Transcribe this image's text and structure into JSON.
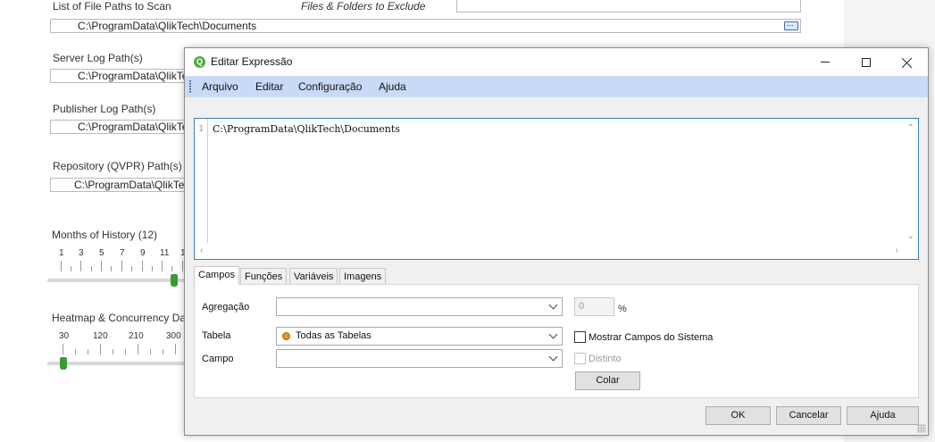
{
  "background": {
    "file_paths_label": "List of File Paths to Scan",
    "exclude_label": "Files & Folders to Exclude",
    "file_path_value": "C:\\ProgramData\\QlikTech\\Documents",
    "server_log_label": "Server Log Path(s)",
    "server_log_value": "C:\\ProgramData\\QlikTe",
    "publisher_log_label": "Publisher Log Path(s)",
    "publisher_log_value": "C:\\ProgramData\\QlikTe",
    "repository_label": "Repository (QVPR) Path(s)",
    "repository_value": "C:\\ProgramData\\QlikTec",
    "months_label": "Months of History (12)",
    "months_ticks": [
      "1",
      "3",
      "5",
      "7",
      "9",
      "11",
      "1"
    ],
    "months_value": 12,
    "heatmap_label": "Heatmap & Concurrency Da",
    "heatmap_ticks": [
      "30",
      "120",
      "210",
      "300"
    ],
    "heatmap_value": 30
  },
  "dialog": {
    "title": "Editar Expressão",
    "app_icon_letter": "Q",
    "menu": [
      "Arquivo",
      "Editar",
      "Configuração",
      "Ajuda"
    ],
    "editor": {
      "line_number": "1",
      "code": "C:\\ProgramData\\QlikTech\\Documents"
    },
    "tabs": [
      "Campos",
      "Funções",
      "Variáveis",
      "Imagens"
    ],
    "active_tab": "Campos",
    "fields": {
      "aggregation_label": "Agregação",
      "aggregation_value": "",
      "percent_value": "0",
      "percent_symbol": "%",
      "table_label": "Tabela",
      "table_value": "Todas as Tabelas",
      "field_label": "Campo",
      "field_value": "",
      "show_system_fields_label": "Mostrar Campos do Sistema",
      "distinct_label": "Distinto",
      "paste_button": "Colar"
    },
    "buttons": {
      "ok": "OK",
      "cancel": "Cancelar",
      "help": "Ajuda"
    }
  }
}
